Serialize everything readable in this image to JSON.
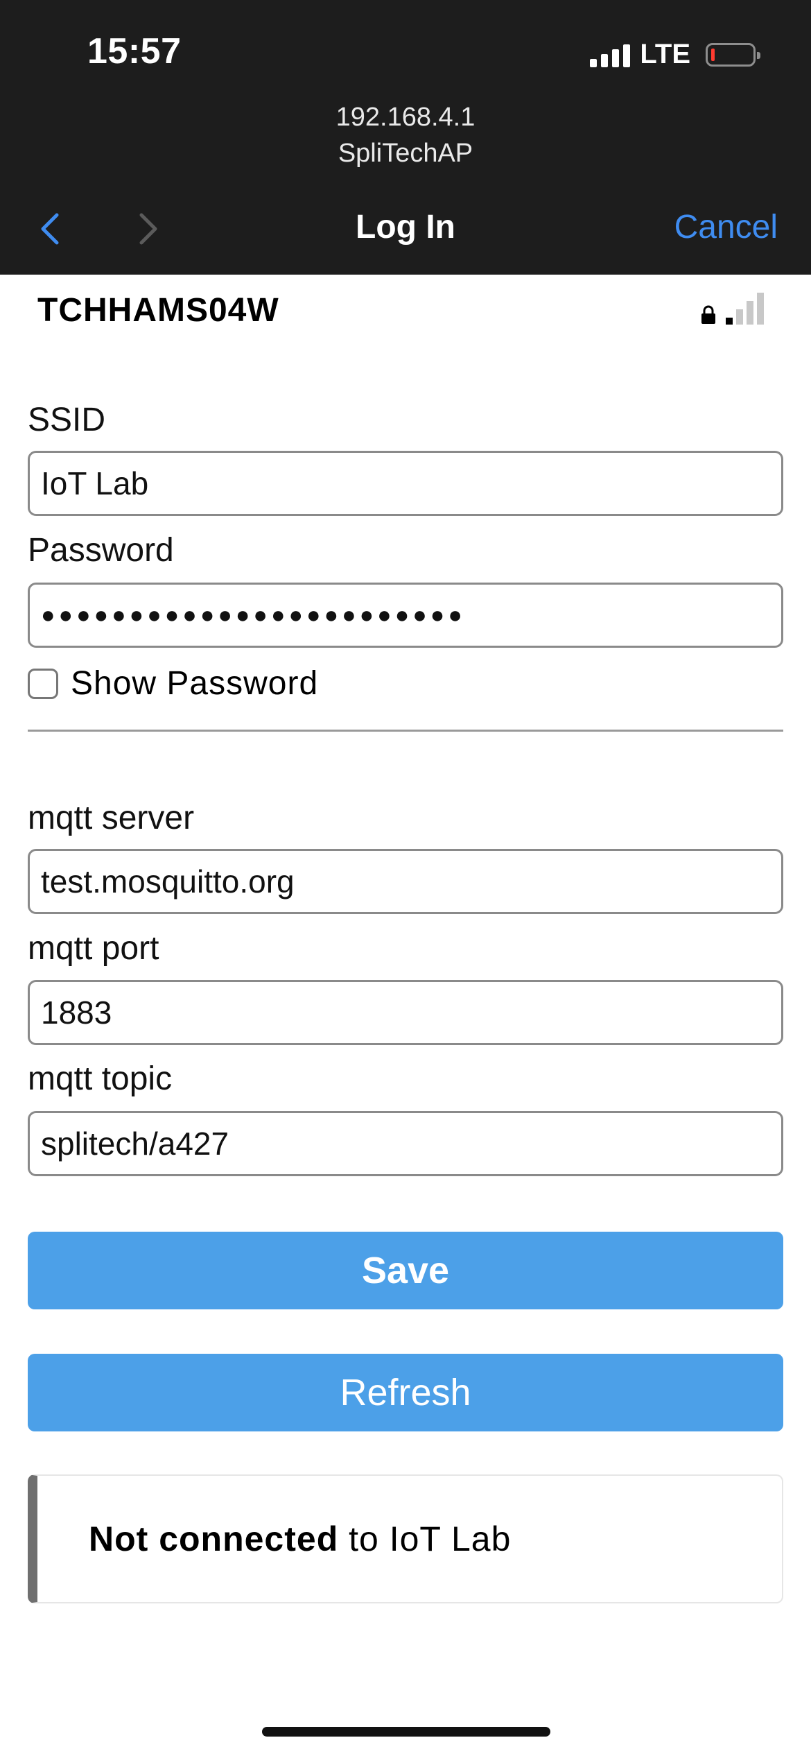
{
  "status_bar": {
    "time": "15:57",
    "network": "LTE",
    "battery_level": "low"
  },
  "browser": {
    "url": "192.168.4.1",
    "network_name": "SpliTechAP",
    "title": "Log In",
    "cancel_label": "Cancel",
    "accent_color": "#3f8cf0"
  },
  "device": {
    "name": "TCHHAMS04W"
  },
  "form": {
    "ssid_label": "SSID",
    "ssid_value": "IoT Lab",
    "password_label": "Password",
    "password_value": "●●●●●●●●●●●●●●●●●●●●●●●●",
    "show_password_label": "Show Password",
    "mqtt_server_label": "mqtt server",
    "mqtt_server_value": "test.mosquitto.org",
    "mqtt_port_label": "mqtt port",
    "mqtt_port_value": "1883",
    "mqtt_topic_label": "mqtt topic",
    "mqtt_topic_value": "splitech/a427"
  },
  "buttons": {
    "save_label": "Save",
    "refresh_label": "Refresh",
    "color": "#4ca0e8"
  },
  "message": {
    "bold": "Not connected",
    "rest": " to IoT Lab"
  }
}
